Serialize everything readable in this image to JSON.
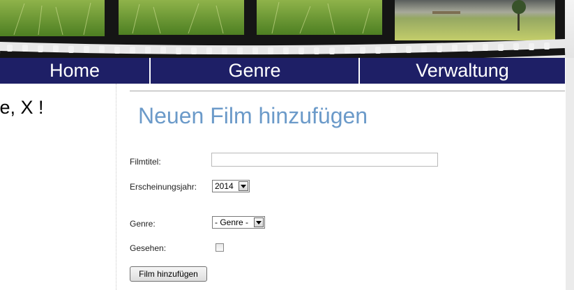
{
  "nav": {
    "items": [
      {
        "label": "Home"
      },
      {
        "label": "Genre"
      },
      {
        "label": "Verwaltung"
      }
    ]
  },
  "sidebar": {
    "welcome_text": "ome, X !"
  },
  "form": {
    "title": "Neuen Film hinzufügen",
    "title_field": {
      "label": "Filmtitel:",
      "value": "",
      "placeholder": ""
    },
    "year": {
      "label": "Erscheinungsjahr:",
      "selected": "2014"
    },
    "genre": {
      "label": "Genre:",
      "selected": "- Genre -"
    },
    "seen": {
      "label": "Gesehen:",
      "checked": false
    },
    "submit_label": "Film hinzufügen"
  },
  "colors": {
    "nav_bg": "#1e1f66",
    "title_color": "#6b9ac9"
  }
}
